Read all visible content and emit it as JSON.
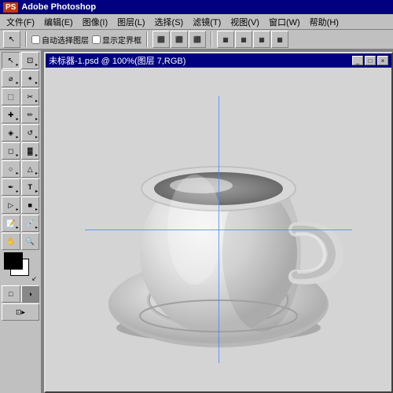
{
  "app": {
    "title": "Adobe Photoshop",
    "title_icon": "PS"
  },
  "menu": {
    "items": [
      "文件(F)",
      "编辑(E)",
      "图像(I)",
      "图层(L)",
      "选择(S)",
      "滤镜(T)",
      "视图(V)",
      "窗口(W)",
      "帮助(H)"
    ]
  },
  "options_bar": {
    "checkbox1_label": "自动选择图层",
    "checkbox2_label": "显示定界框",
    "arrow_tool": "↖"
  },
  "document": {
    "title": "未标器-1.psd @ 100%(图层 7,RGB)",
    "win_btn_minimize": "_",
    "win_btn_maximize": "□",
    "win_btn_close": "×"
  },
  "tools": [
    {
      "icon": "↖",
      "name": "move"
    },
    {
      "icon": "⊡",
      "name": "marquee"
    },
    {
      "icon": "↖",
      "name": "lasso"
    },
    {
      "icon": "✂",
      "name": "crop"
    },
    {
      "icon": "✏",
      "name": "brush"
    },
    {
      "icon": "◈",
      "name": "stamp"
    },
    {
      "icon": "⚊",
      "name": "eraser"
    },
    {
      "icon": "◻",
      "name": "shape"
    },
    {
      "icon": "🪣",
      "name": "fill"
    },
    {
      "icon": "T",
      "name": "text"
    },
    {
      "icon": "⬡",
      "name": "pen"
    },
    {
      "icon": "✋",
      "name": "hand"
    },
    {
      "icon": "🔍",
      "name": "zoom"
    }
  ]
}
